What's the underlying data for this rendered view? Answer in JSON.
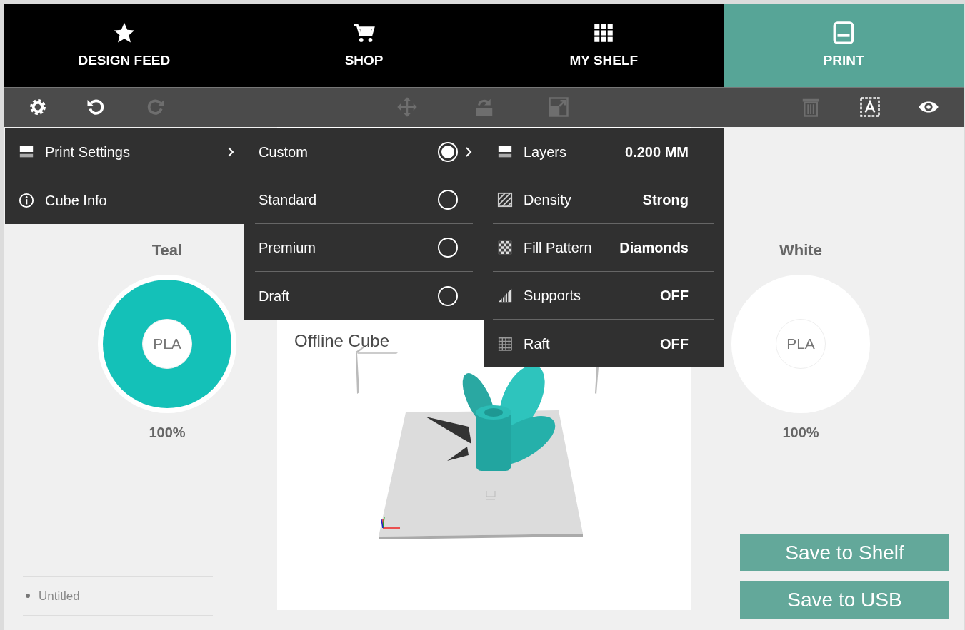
{
  "nav_tabs": [
    {
      "label": "DESIGN FEED",
      "selected": false
    },
    {
      "label": "SHOP",
      "selected": false
    },
    {
      "label": "MY SHELF",
      "selected": false
    },
    {
      "label": "PRINT",
      "selected": true
    }
  ],
  "toolbar": [
    {
      "disabled": false
    },
    {
      "disabled": false
    },
    {
      "disabled": true
    },
    {
      "disabled": true
    },
    {
      "disabled": true
    },
    {
      "disabled": true
    },
    {
      "disabled": true
    },
    {
      "disabled": false
    },
    {
      "disabled": false
    }
  ],
  "menu": [
    {
      "label": "Print Settings",
      "has_submenu": true
    },
    {
      "label": "Cube Info",
      "has_submenu": false
    }
  ],
  "quality_options": [
    {
      "label": "Custom",
      "selected": true
    },
    {
      "label": "Standard",
      "selected": false
    },
    {
      "label": "Premium",
      "selected": false
    },
    {
      "label": "Draft",
      "selected": false
    }
  ],
  "settings": [
    {
      "label": "Layers",
      "value": "0.200 MM"
    },
    {
      "label": "Density",
      "value": "Strong"
    },
    {
      "label": "Fill Pattern",
      "value": "Diamonds"
    },
    {
      "label": "Supports",
      "value": "OFF"
    },
    {
      "label": "Raft",
      "value": "OFF"
    }
  ],
  "viewport": {
    "title": "Offline Cube"
  },
  "filaments": [
    {
      "name": "Teal",
      "material": "PLA",
      "percent": "100%",
      "color": "#14c1b8"
    },
    {
      "name": "White",
      "material": "PLA",
      "percent": "100%",
      "color": "#ffffff"
    }
  ],
  "files": [
    "Untitled"
  ],
  "buttons": [
    "Save to Shelf",
    "Save to USB"
  ]
}
